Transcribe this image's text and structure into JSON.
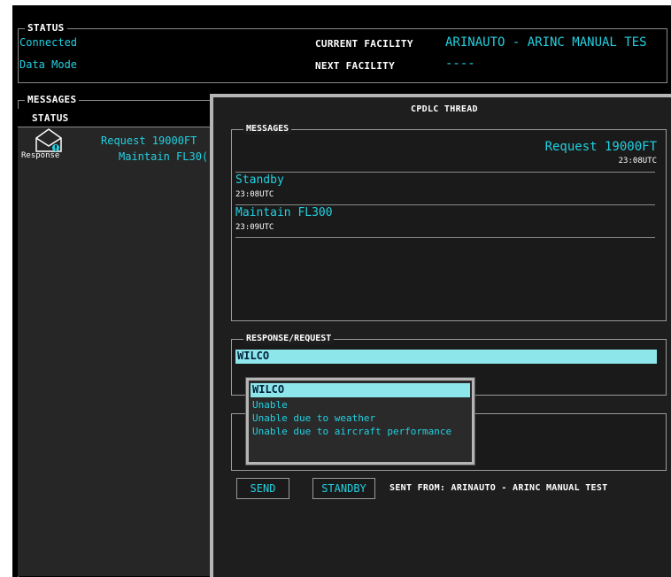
{
  "colors": {
    "accent_cyan": "#22d0e0",
    "selection": "#8de6ea",
    "panel_bg": "#1e1e1e"
  },
  "status": {
    "legend": "STATUS",
    "connection": "Connected",
    "mode": "Data Mode",
    "current_facility_label": "CURRENT FACILITY",
    "current_facility_value": "ARINAUTO - ARINC MANUAL TES",
    "next_facility_label": "NEXT FACILITY",
    "next_facility_value": "----"
  },
  "messages_list": {
    "legend": "MESSAGES",
    "column_status": "STATUS",
    "items": [
      {
        "icon": "envelope-response-icon",
        "status": "Response",
        "line1": "Request 19000FT",
        "line2": "Maintain FL30("
      }
    ]
  },
  "thread": {
    "title": "CPDLC THREAD",
    "messages_legend": "MESSAGES",
    "messages": [
      {
        "text": "Request 19000FT",
        "time": "23:08UTC",
        "align": "right"
      },
      {
        "text": "Standby",
        "time": "23:08UTC",
        "align": "left"
      },
      {
        "text": "Maintain FL300",
        "time": "23:09UTC",
        "align": "left"
      }
    ],
    "response_legend": "RESPONSE/REQUEST",
    "response_value": "WILCO",
    "options": [
      "WILCO",
      "Unable",
      "Unable due to weather",
      "Unable due to aircraft performance"
    ],
    "selected_option": "WILCO",
    "send_label": "SEND",
    "standby_label": "STANDBY",
    "sent_from": "SENT FROM: ARINAUTO - ARINC MANUAL TEST"
  }
}
